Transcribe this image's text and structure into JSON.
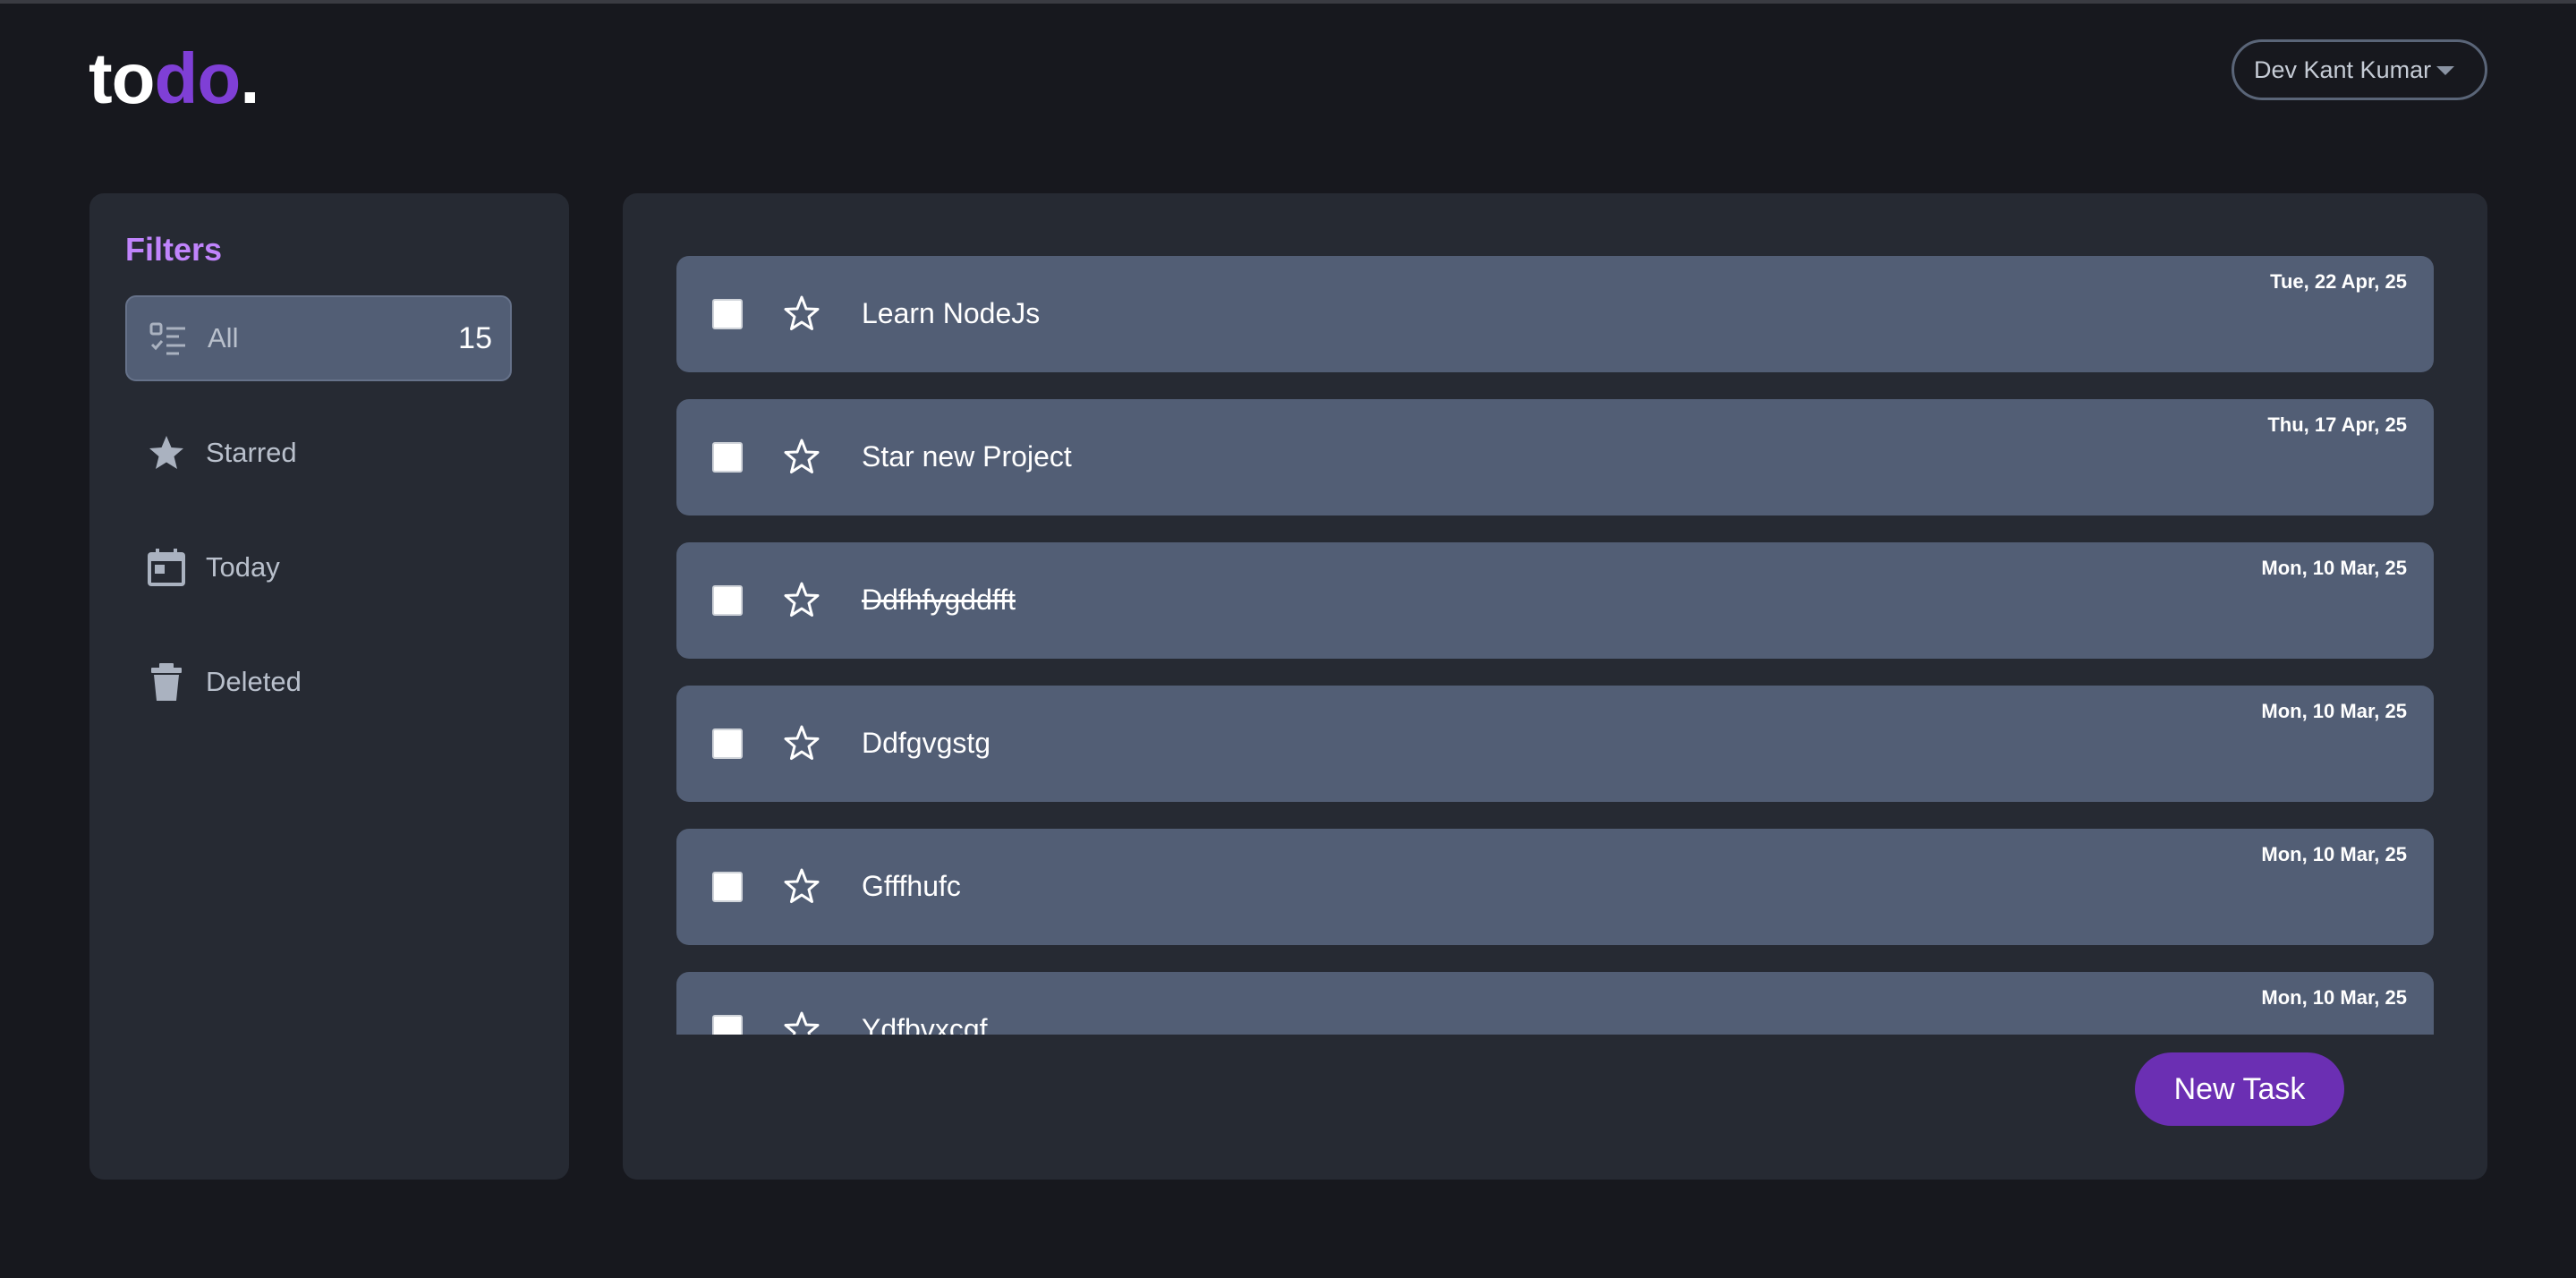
{
  "logo": {
    "part1": "to",
    "part2": "do",
    "part3": "."
  },
  "user": {
    "name": "Dev Kant Kumar"
  },
  "sidebar": {
    "title": "Filters",
    "items": [
      {
        "label": "All",
        "count": "15",
        "icon": "list-check-icon",
        "active": true
      },
      {
        "label": "Starred",
        "icon": "star-icon"
      },
      {
        "label": "Today",
        "icon": "calendar-icon"
      },
      {
        "label": "Deleted",
        "icon": "trash-icon"
      }
    ]
  },
  "tasks": [
    {
      "title": "Learn NodeJs",
      "date": "Tue, 22 Apr, 25",
      "completed": false
    },
    {
      "title": "Star new Project",
      "date": "Thu, 17 Apr, 25",
      "completed": false
    },
    {
      "title": "Ddfhfygddfft",
      "date": "Mon, 10 Mar, 25",
      "completed": true
    },
    {
      "title": "Ddfgvgstg",
      "date": "Mon, 10 Mar, 25",
      "completed": false
    },
    {
      "title": "Gfffhufc",
      "date": "Mon, 10 Mar, 25",
      "completed": false
    },
    {
      "title": "Ydfbvxcgf",
      "date": "Mon, 10 Mar, 25",
      "completed": false
    }
  ],
  "actions": {
    "new_task": "New Task"
  },
  "colors": {
    "background": "#17181e",
    "panel": "#262a33",
    "task_card": "#525e75",
    "accent": "#7f3fd6",
    "filters_title": "#c084fc",
    "button": "#6b2fb3"
  }
}
